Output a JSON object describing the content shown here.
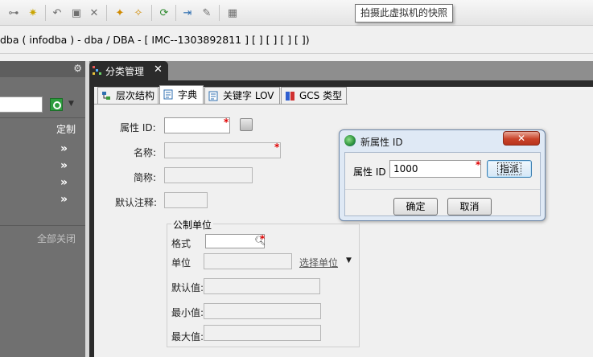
{
  "toolbar": {
    "icons": [
      "key-icon",
      "sparkle-icon",
      "undo-icon",
      "save-icon",
      "close-icon",
      "wand-icon",
      "wand-plus-icon",
      "refresh-icon",
      "indent-icon",
      "rename-icon",
      "grid-icon"
    ],
    "tooltip": "拍摄此虚拟机的快照"
  },
  "window": {
    "title": "dba ( infodba ) - dba / DBA - [ IMC--1303892811 ] [ ] [ ] [ ]  [ ])"
  },
  "left_panel": {
    "custom_label": "定制",
    "close_all_label": "全部关闭",
    "arrows": [
      "»",
      "»",
      "»",
      "»"
    ]
  },
  "editor": {
    "tab_label": "分类管理",
    "tab_close": "✕",
    "subtabs": [
      {
        "label": "层次结构",
        "icon": "hierarchy-icon"
      },
      {
        "label": "字典",
        "icon": "dictionary-icon"
      },
      {
        "label": "关键字 LOV",
        "icon": "keyword-lov-icon"
      },
      {
        "label": "GCS 类型",
        "icon": "gcs-type-icon"
      }
    ]
  },
  "form": {
    "attr_id_label": "属性 ID:",
    "name_label": "名称:",
    "short_label": "简称:",
    "default_note_label": "默认注释:",
    "required_mark": "*",
    "unit_group": {
      "title": "公制单位",
      "format_label": "格式",
      "unit_label": "单位",
      "select_unit_link": "选择单位",
      "default_label": "默认值:",
      "min_label": "最小值:",
      "max_label": "最大值:"
    }
  },
  "dialog": {
    "title": "新属性 ID",
    "close_label": "✕",
    "field_label": "属性 ID",
    "field_value": "1000",
    "assign_button": "指派",
    "ok_button": "确定",
    "cancel_button": "取消"
  }
}
